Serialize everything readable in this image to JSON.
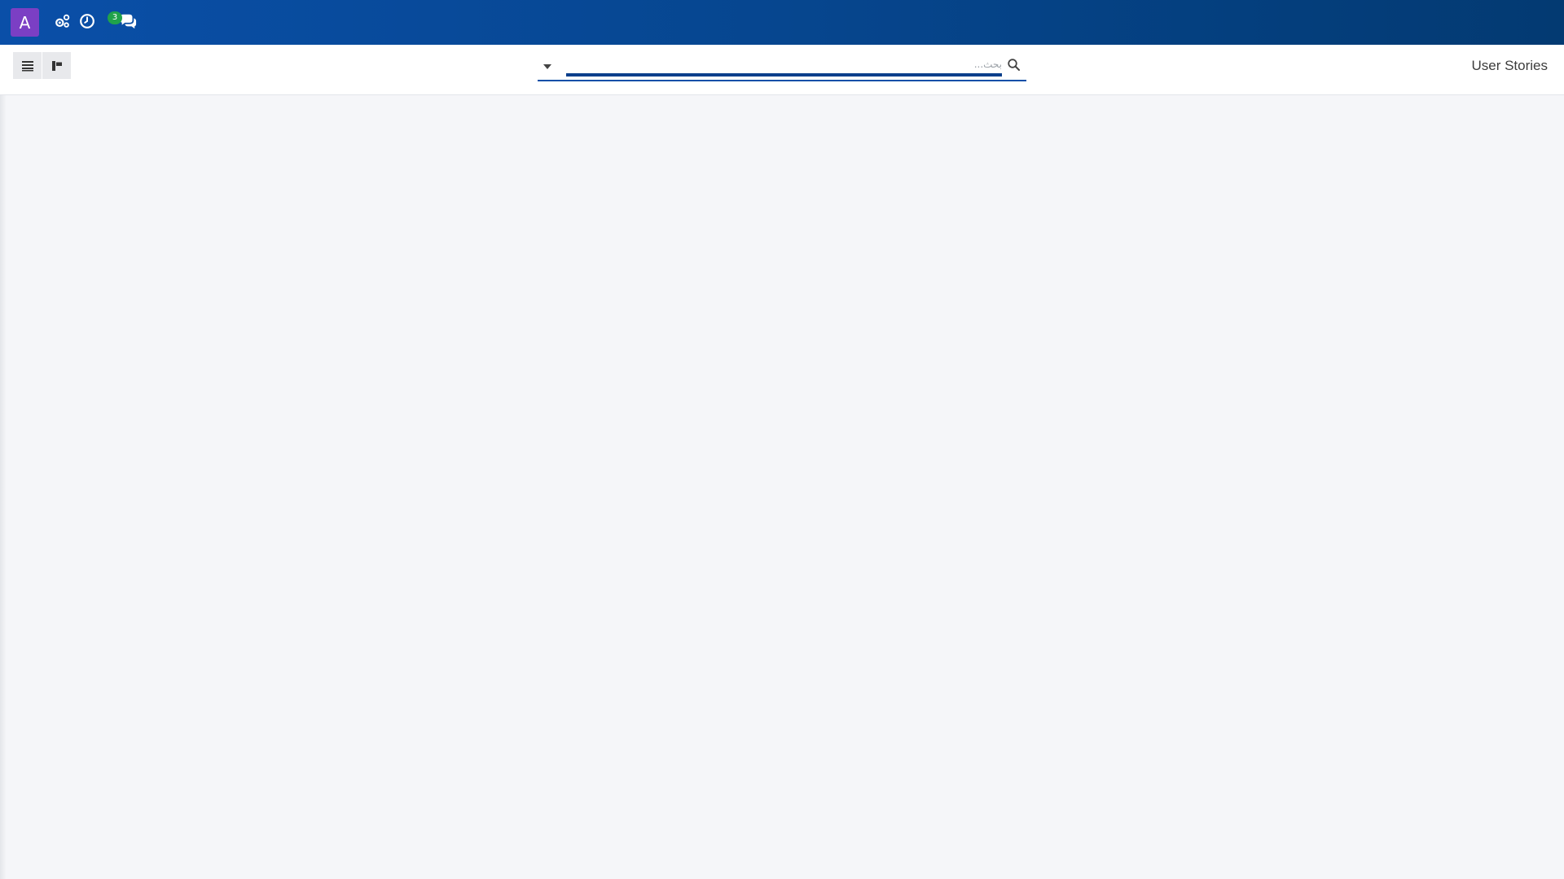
{
  "topbar": {
    "avatar_letter": "A",
    "icons": [
      "settings-gears-icon",
      "clock-icon",
      "chat-bubbles-icon"
    ],
    "chat_badge": "3",
    "colors": {
      "bar_start": "#0a4fa8",
      "bar_end": "#033a72",
      "avatar": "#7b3fc4",
      "badge": "#20a24a"
    }
  },
  "controlbar": {
    "view_buttons": [
      "list-view-icon",
      "kanban-view-icon"
    ],
    "search": {
      "placeholder": "بحث..."
    },
    "page_title": "User Stories"
  }
}
